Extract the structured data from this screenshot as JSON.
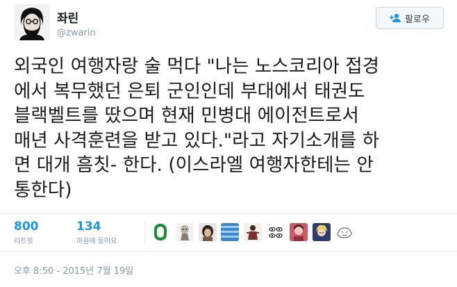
{
  "author": {
    "display_name": "좌린",
    "handle": "@zwarin",
    "avatar": "bearded-man-portrait"
  },
  "follow_button": {
    "label": "팔로우",
    "icon": "add-user-icon"
  },
  "tweet": {
    "lines": [
      "외국인 여행자랑 술 먹다 \"나는 노스코리아 접경",
      "에서 복무했던 은퇴 군인인데 부대에서 태권도",
      "블랙벨트를 땄으며 현재 민병대 에이전트로서",
      "매년 사격훈련을 받고 있다.\"라고 자기소개를 하",
      "면 대개 흠칫- 한다. (이스라엘 여행자한테는 안",
      "통한다)"
    ]
  },
  "stats": {
    "retweets": {
      "value": "800",
      "label": "리트윗"
    },
    "likes": {
      "value": "134",
      "label": "마음에 들어요"
    }
  },
  "likers": [
    {
      "name": "green-badge-avatar",
      "color": "#1f8c3a"
    },
    {
      "name": "cartoon-doll-avatar",
      "color": "#b9b3ad"
    },
    {
      "name": "dark-hair-avatar",
      "color": "#6b5a4a"
    },
    {
      "name": "blue-stripes-avatar",
      "color": "#3d86c7"
    },
    {
      "name": "red-figure-avatar",
      "color": "#7a2e2e"
    },
    {
      "name": "eyes-doodle-avatar",
      "color": "#e8e8e8"
    },
    {
      "name": "pink-portrait-avatar",
      "color": "#c85c6a"
    },
    {
      "name": "blonde-character-avatar",
      "color": "#e9cf6a"
    },
    {
      "name": "sketch-avatar",
      "color": "#dadada"
    }
  ],
  "timestamp": "오후 8:50 - 2015년 7월 19일",
  "colors": {
    "link_blue": "#1b95e0",
    "muted_gray": "#8899a6",
    "border": "#e6ecf0"
  }
}
